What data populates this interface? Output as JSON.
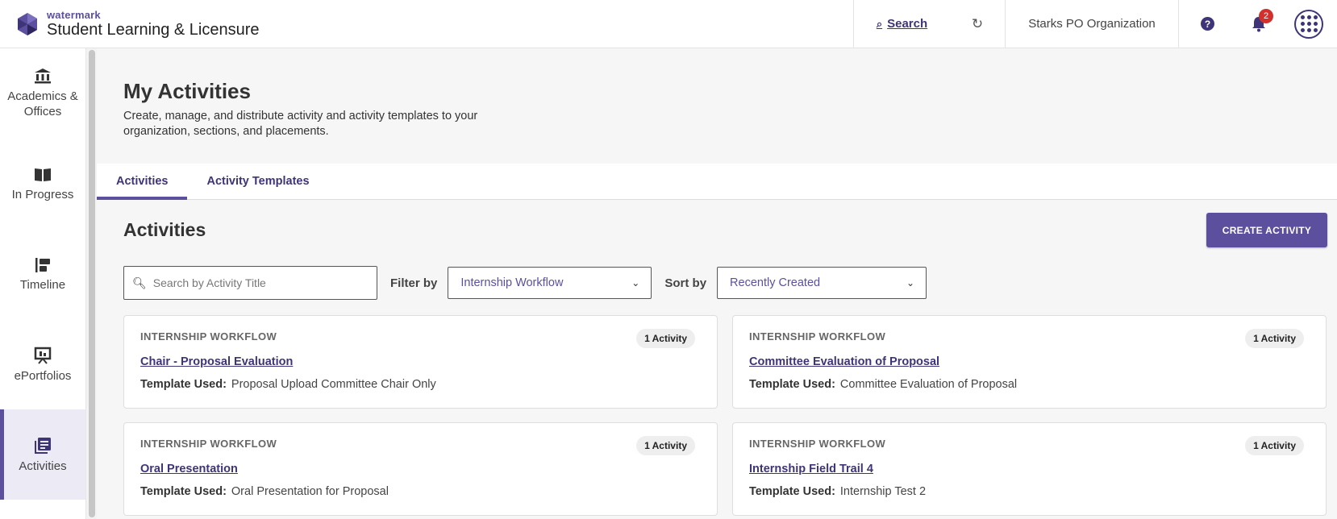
{
  "header": {
    "brand_small": "watermark",
    "brand_big": "Student Learning & Licensure",
    "search_label": "Search",
    "org_name": "Starks PO Organization",
    "notification_count": "2",
    "icons": [
      "search-icon",
      "sync-icon",
      "help-icon",
      "bell-icon",
      "apps-grid-icon"
    ]
  },
  "sidebar": {
    "items": [
      {
        "label": "Academics & Offices",
        "icon": "institution-icon"
      },
      {
        "label": "In Progress",
        "icon": "book-icon"
      },
      {
        "label": "Timeline",
        "icon": "timeline-icon"
      },
      {
        "label": "ePortfolios",
        "icon": "presentation-icon"
      },
      {
        "label": "Activities",
        "icon": "activities-icon",
        "active": true
      }
    ]
  },
  "page": {
    "title": "My Activities",
    "description": "Create, manage, and distribute activity and activity templates to your organization, sections, and placements."
  },
  "tabs": [
    {
      "label": "Activities",
      "active": true
    },
    {
      "label": "Activity Templates",
      "active": false
    }
  ],
  "content": {
    "section_title": "Activities",
    "create_button": "CREATE ACTIVITY",
    "search_placeholder": "Search by Activity Title",
    "filter_label": "Filter by",
    "filter_value": "Internship Workflow",
    "sort_label": "Sort by",
    "sort_value": "Recently Created"
  },
  "cards": [
    {
      "kicker": "INTERNSHIP WORKFLOW",
      "count": "1 Activity",
      "title": "Chair - Proposal Evaluation",
      "template_label": "Template Used:",
      "template": "Proposal Upload Committee Chair Only"
    },
    {
      "kicker": "INTERNSHIP WORKFLOW",
      "count": "1 Activity",
      "title": "Committee Evaluation of Proposal",
      "template_label": "Template Used:",
      "template": "Committee Evaluation of Proposal"
    },
    {
      "kicker": "INTERNSHIP WORKFLOW",
      "count": "1 Activity",
      "title": "Oral Presentation",
      "template_label": "Template Used:",
      "template": "Oral Presentation for Proposal"
    },
    {
      "kicker": "INTERNSHIP WORKFLOW",
      "count": "1 Activity",
      "title": "Internship Field Trail 4",
      "template_label": "Template Used:",
      "template": "Internship Test 2"
    }
  ],
  "colors": {
    "brand": "#5b4f9e",
    "link": "#3e3478",
    "badge": "#d2302c"
  }
}
